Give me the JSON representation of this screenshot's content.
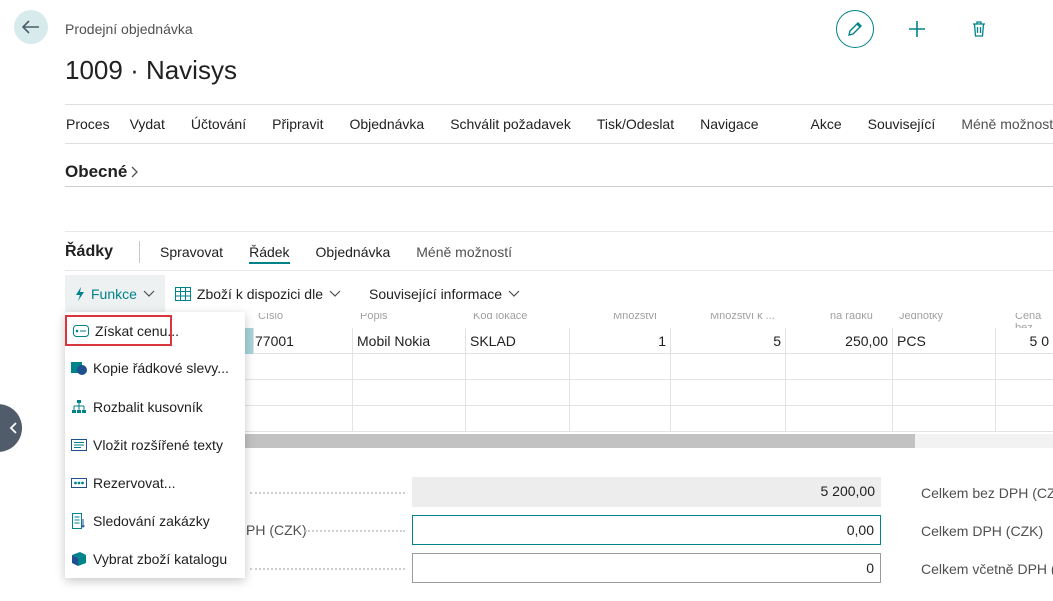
{
  "header": {
    "breadcrumb": "Prodejní objednávka",
    "title": "1009 · Navisys"
  },
  "menu": {
    "items": [
      "Proces",
      "Vydat",
      "Účtování",
      "Připravit",
      "Objednávka",
      "Schválit požadavek",
      "Tisk/Odeslat",
      "Navigace"
    ],
    "items2": [
      "Akce",
      "Související",
      "Méně možností"
    ]
  },
  "general": {
    "title": "Obecné"
  },
  "lines": {
    "title": "Řádky",
    "tabs": [
      "Spravovat",
      "Řádek",
      "Objednávka",
      "Méně možností"
    ],
    "actions": {
      "functions": "Funkce",
      "availability": "Zboží k dispozici dle",
      "related": "Související informace"
    },
    "columns": [
      "Číslo",
      "Popis",
      "Kód lokace",
      "Množství",
      "Množství k ...",
      "na řádku",
      "Jednotky",
      "Cena bez"
    ],
    "rows": [
      {
        "no": "77001",
        "description": "Mobil Nokia",
        "location": "SKLAD",
        "qty": "1",
        "qty_to": "5",
        "amount": "250,00",
        "unit": "PCS",
        "price": "5 0"
      }
    ]
  },
  "dropdown": {
    "items": [
      "Získat cenu...",
      "Kopie řádkové slevy...",
      "Rozbalit kusovník",
      "Vložit rozšířené texty",
      "Rezervovat...",
      "Sledování zakázky",
      "Vybrat zboží katalogu"
    ]
  },
  "totals": {
    "left": [
      {
        "label": "",
        "value": "5 200,00"
      },
      {
        "label": "PH (CZK)",
        "value": "0,00"
      },
      {
        "label": "",
        "value": "0"
      }
    ],
    "right": [
      {
        "label": "Celkem bez DPH (CZK"
      },
      {
        "label": "Celkem DPH (CZK)"
      },
      {
        "label": "Celkem včetně DPH (C"
      }
    ]
  },
  "colors": {
    "accent": "#00828a",
    "highlight": "#d9363e"
  }
}
